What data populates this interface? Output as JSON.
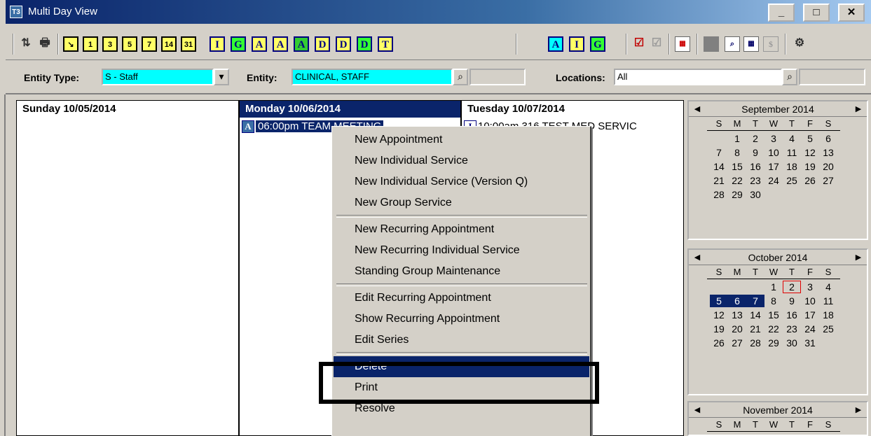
{
  "window": {
    "title": "Multi Day View",
    "app_icon": "T3",
    "minimize": "_",
    "maximize": "□",
    "close": "✕"
  },
  "toolbar": {
    "refresh_icon": "refresh-icon",
    "print_icon": "printer-icon",
    "day_buttons": [
      "1",
      "3",
      "5",
      "7",
      "14",
      "31"
    ],
    "letter_buttons_1": [
      "I",
      "G",
      "A",
      "A",
      "A",
      "D",
      "D",
      "D",
      "T"
    ],
    "letter_buttons_2": [
      "A",
      "I",
      "G"
    ]
  },
  "filters": {
    "entity_type_label": "Entity Type:",
    "entity_type_value": "S - Staff",
    "entity_label": "Entity:",
    "entity_value": "CLINICAL, STAFF",
    "locations_label": "Locations:",
    "locations_value": "All"
  },
  "days": [
    {
      "header": "Sunday 10/05/2014"
    },
    {
      "header": "Monday 10/06/2014",
      "appt_tag": "A",
      "appt_text": "06:00pm TEAM MEETING"
    },
    {
      "header": "Tuesday 10/07/2014",
      "appt_tag": "I",
      "appt_text": "10:00am 316 TEST MED SERVIC"
    }
  ],
  "calendars": [
    {
      "title": "September 2014",
      "dow": [
        "S",
        "M",
        "T",
        "W",
        "T",
        "F",
        "S"
      ],
      "weeks": [
        [
          "",
          "1",
          "2",
          "3",
          "4",
          "5",
          "6"
        ],
        [
          "7",
          "8",
          "9",
          "10",
          "11",
          "12",
          "13"
        ],
        [
          "14",
          "15",
          "16",
          "17",
          "18",
          "19",
          "20"
        ],
        [
          "21",
          "22",
          "23",
          "24",
          "25",
          "26",
          "27"
        ],
        [
          "28",
          "29",
          "30",
          "",
          "",
          "",
          ""
        ]
      ]
    },
    {
      "title": "October 2014",
      "dow": [
        "S",
        "M",
        "T",
        "W",
        "T",
        "F",
        "S"
      ],
      "weeks": [
        [
          "",
          "",
          "",
          "1",
          "2",
          "3",
          "4"
        ],
        [
          "5",
          "6",
          "7",
          "8",
          "9",
          "10",
          "11"
        ],
        [
          "12",
          "13",
          "14",
          "15",
          "16",
          "17",
          "18"
        ],
        [
          "19",
          "20",
          "21",
          "22",
          "23",
          "24",
          "25"
        ],
        [
          "26",
          "27",
          "28",
          "29",
          "30",
          "31",
          ""
        ]
      ]
    },
    {
      "title": "November 2014",
      "dow": [
        "S",
        "M",
        "T",
        "W",
        "T",
        "F",
        "S"
      ],
      "weeks": []
    }
  ],
  "context_menu": {
    "groups": [
      [
        "New Appointment",
        "New Individual Service",
        "New Individual Service (Version Q)",
        "New Group Service"
      ],
      [
        "New Recurring Appointment",
        "New Recurring Individual Service",
        "Standing Group Maintenance"
      ],
      [
        "Edit Recurring Appointment",
        "Show Recurring Appointment",
        "Edit Series"
      ],
      [
        "Delete",
        "Print",
        "Resolve"
      ]
    ],
    "highlighted": "Delete"
  }
}
